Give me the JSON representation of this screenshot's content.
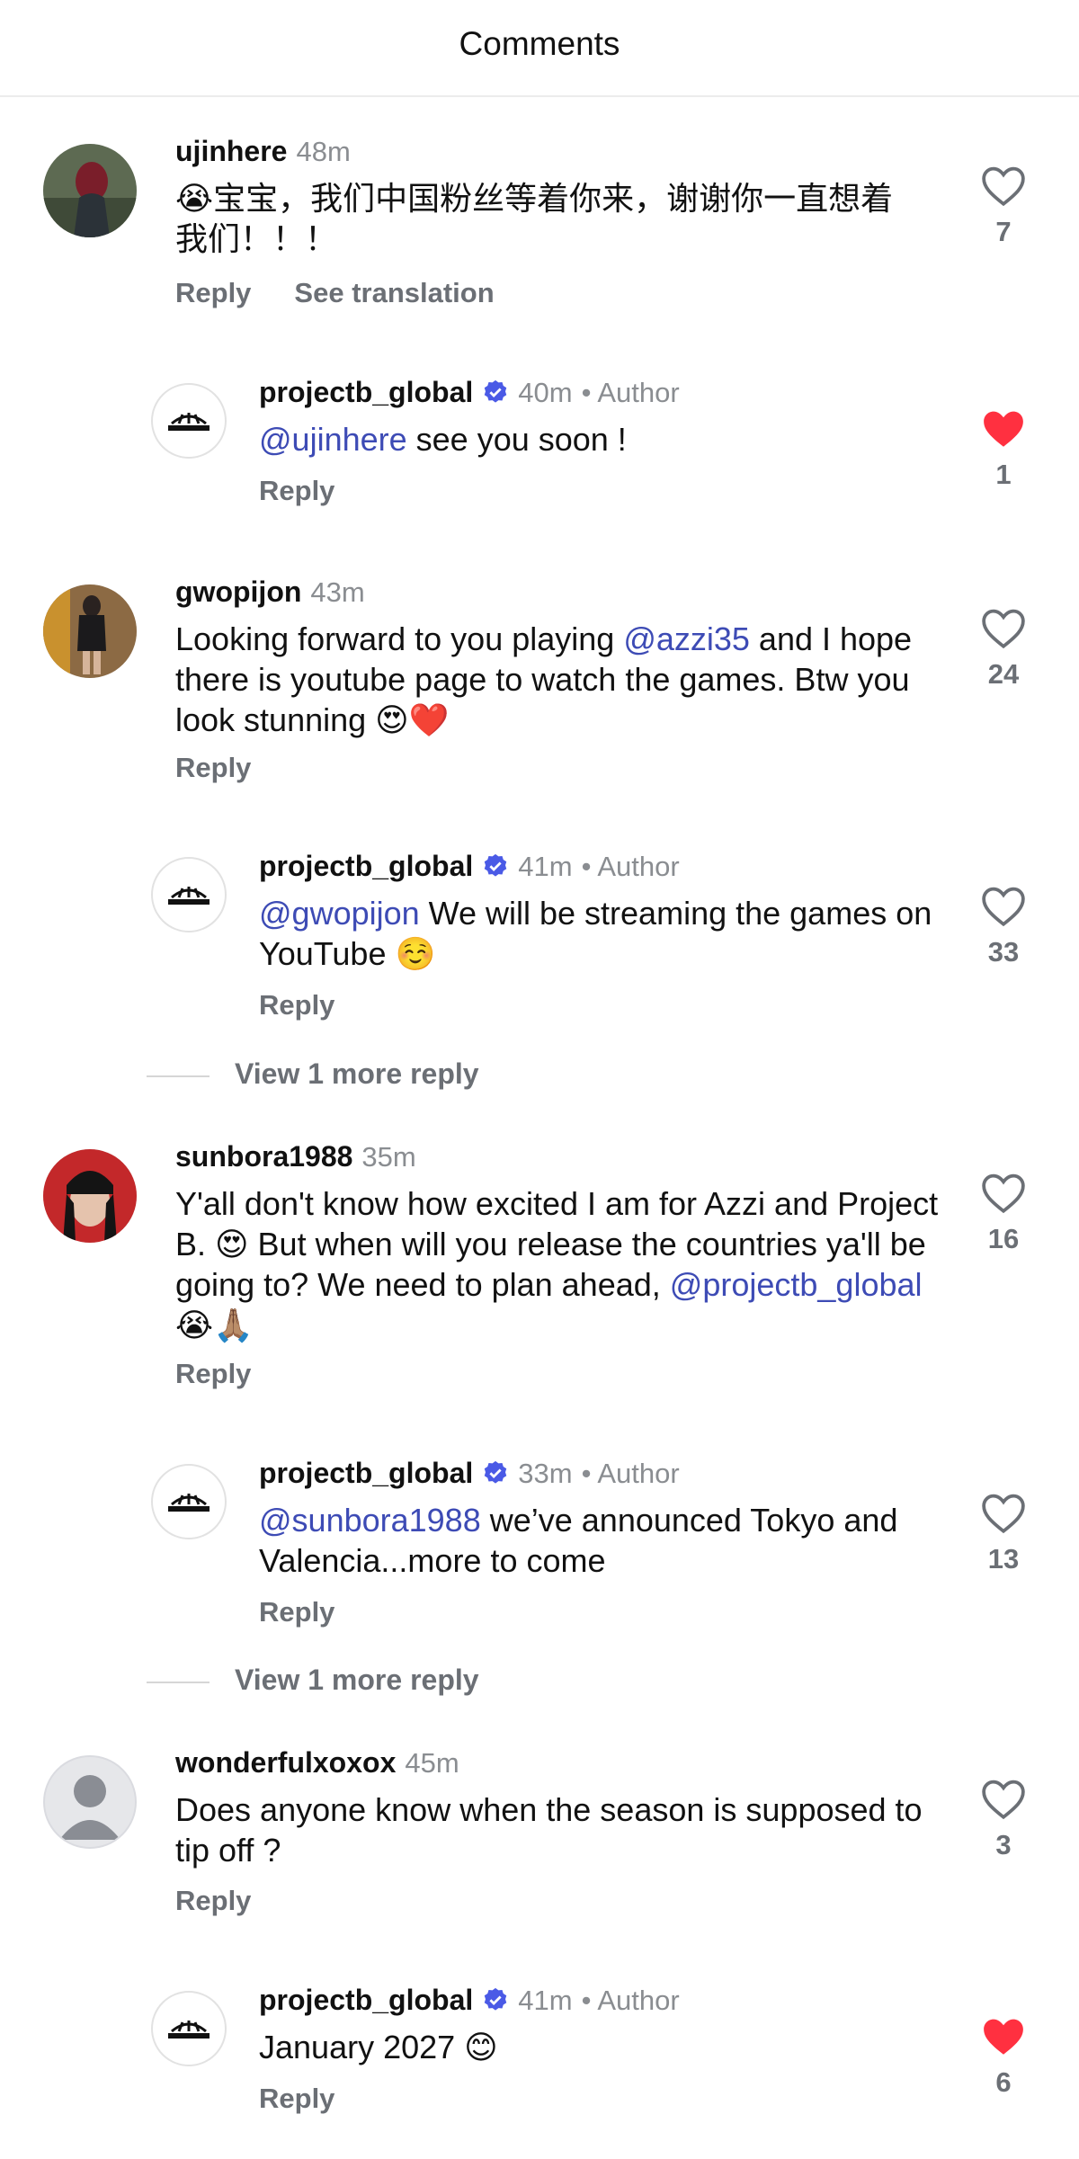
{
  "header": {
    "title": "Comments"
  },
  "labels": {
    "reply": "Reply",
    "see_translation": "See translation",
    "author": "• Author"
  },
  "colors": {
    "mention": "#3d4bb5",
    "like_active": "#ff3040",
    "verified": "#4a5ae6"
  },
  "comments": [
    {
      "username": "ujinhere",
      "time": "48m",
      "line1": "😭宝宝，我们中国粉丝等着你来，谢谢你一直想着",
      "line2": "我们！！！",
      "likes": "7",
      "liked": false
    },
    {
      "username": "projectb_global",
      "time": "40m",
      "mention": "@ujinhere",
      "text": " see you soon !",
      "likes": "1",
      "liked": true
    },
    {
      "username": "gwopijon",
      "time": "43m",
      "pre": "Looking forward to you playing ",
      "mention": "@azzi35",
      "post": " and I hope there is youtube page to watch the games. Btw you look stunning 😍❤️",
      "likes": "24",
      "liked": false
    },
    {
      "username": "projectb_global",
      "time": "41m",
      "mention": "@gwopijon",
      "text": " We will be streaming the games on YouTube ☺️",
      "likes": "33",
      "liked": false
    },
    {
      "username": "sunbora1988",
      "time": "35m",
      "pre": "Y'all don't know how excited I am for Azzi and Project B. 😍 But when will you release the countries ya'll be going to? We need to plan ahead, ",
      "mention": "@projectb_global",
      "post": " 😭🙏🏽",
      "likes": "16",
      "liked": false
    },
    {
      "username": "projectb_global",
      "time": "33m",
      "mention": "@sunbora1988",
      "text": " we’ve announced Tokyo and Valencia...more to come",
      "likes": "13",
      "liked": false
    },
    {
      "username": "wonderfulxoxox",
      "time": "45m",
      "text": "Does anyone know when the season is supposed to tip off ?",
      "likes": "3",
      "liked": false
    },
    {
      "username": "projectb_global",
      "time": "41m",
      "text": "January 2027 😊",
      "likes": "6",
      "liked": true
    }
  ],
  "view_more": "View 1 more reply"
}
